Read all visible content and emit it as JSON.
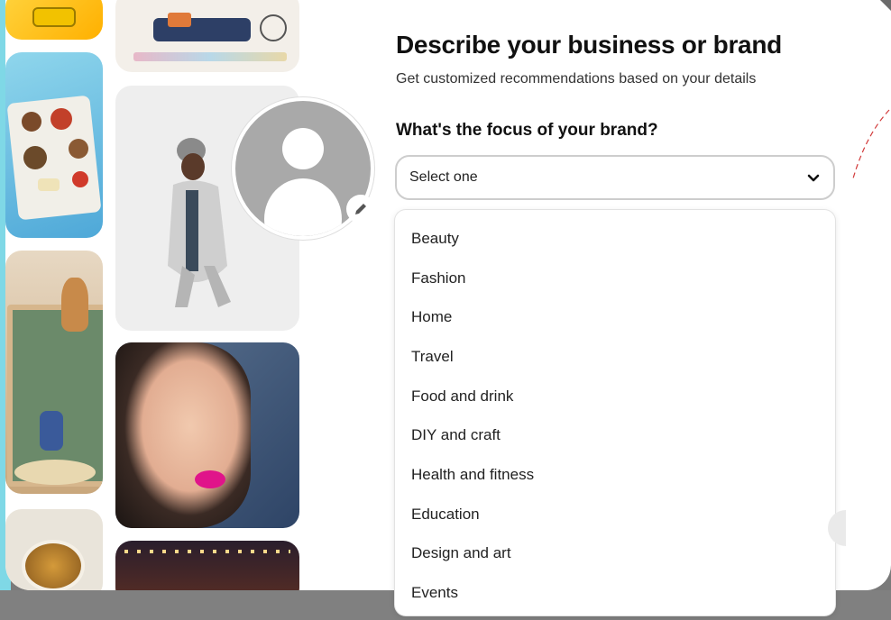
{
  "form": {
    "title": "Describe your business or brand",
    "subtitle": "Get customized recommendations based on your details",
    "question": "What's the focus of your brand?"
  },
  "select": {
    "value": "Select one",
    "icon": "chevron-down-icon"
  },
  "options": [
    "Beauty",
    "Fashion",
    "Home",
    "Travel",
    "Food and drink",
    "DIY and craft",
    "Health and fitness",
    "Education",
    "Design and art",
    "Events"
  ],
  "avatar": {
    "edit_icon": "pencil-icon"
  },
  "colors": {
    "text": "#111111",
    "border": "#cdcdcd",
    "modal_bg": "#ffffff",
    "overlay": "#7a7a7a"
  }
}
